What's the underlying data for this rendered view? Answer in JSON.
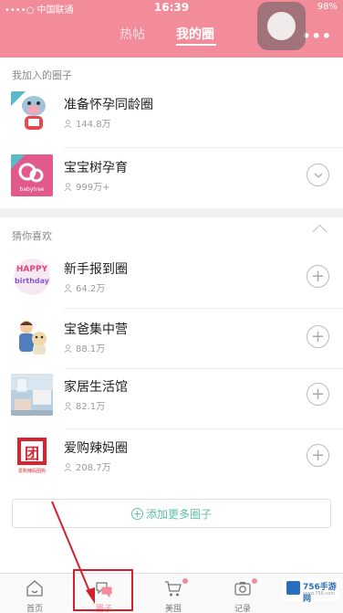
{
  "status_bar": {
    "carrier": "••••○ 中国联通 ",
    "time": "16:39",
    "battery": "98%"
  },
  "header": {
    "tab_hot": "热帖",
    "tab_mine": "我的圈",
    "more": "•••"
  },
  "joined": {
    "title": "我加入的圈子",
    "items": [
      {
        "name": "准备怀孕同龄圈",
        "count": "144.8万"
      },
      {
        "name": "宝宝树孕育",
        "count": "999万+"
      }
    ]
  },
  "guess": {
    "title": "猜你喜欢",
    "items": [
      {
        "name": "新手报到圈",
        "count": "64.2万"
      },
      {
        "name": "宝爸集中营",
        "count": "88.1万"
      },
      {
        "name": "家居生活馆",
        "count": "82.1万"
      },
      {
        "name": "爱购辣妈圈",
        "count": "208.7万"
      }
    ]
  },
  "add_more": "添加更多圈子",
  "tabbar": {
    "items": [
      {
        "label": "首页"
      },
      {
        "label": "圈子"
      },
      {
        "label": "美囤"
      },
      {
        "label": "记录"
      }
    ]
  },
  "thumb_text": {
    "babytree": "babytree",
    "happy": "HAPPY",
    "birthday": "birthday",
    "tuan": "团",
    "tuan_sub": "爱购辣妈团购"
  },
  "watermark": {
    "main": "756手游网",
    "sub": "www.756.com"
  },
  "colors": {
    "accent": "#f28b9a",
    "green": "#5fc1a9",
    "highlight": "#d2202c"
  }
}
